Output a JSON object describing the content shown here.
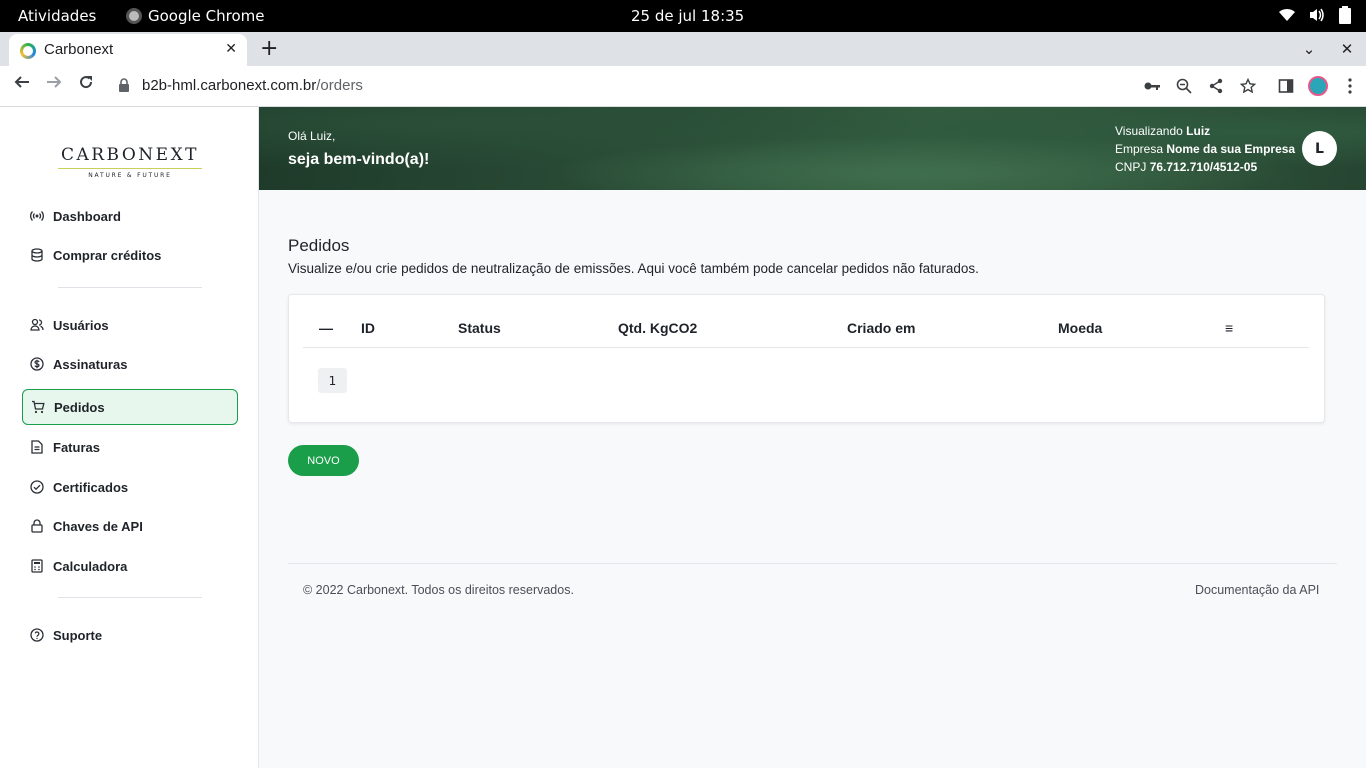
{
  "system_bar": {
    "activities": "Atividades",
    "app_name": "Google Chrome",
    "clock": "25 de jul  18:35"
  },
  "browser": {
    "tab_title": "Carbonext",
    "tab_close": "✕",
    "new_tab": "+",
    "url_host": "b2b-hml.carbonext.com.br",
    "url_path": "/orders"
  },
  "sidebar": {
    "logo_brand": "CARBONEXT",
    "logo_tag": "NATURE & FUTURE",
    "items": [
      {
        "label": "Dashboard",
        "icon": "broadcast-icon"
      },
      {
        "label": "Comprar créditos",
        "icon": "database-icon"
      },
      {
        "label": "Usuários",
        "icon": "users-icon"
      },
      {
        "label": "Assinaturas",
        "icon": "dollar-circle-icon"
      },
      {
        "label": "Pedidos",
        "icon": "cart-icon"
      },
      {
        "label": "Faturas",
        "icon": "file-icon"
      },
      {
        "label": "Certificados",
        "icon": "check-circle-icon"
      },
      {
        "label": "Chaves de API",
        "icon": "lock-icon"
      },
      {
        "label": "Calculadora",
        "icon": "calculator-icon"
      },
      {
        "label": "Suporte",
        "icon": "help-circle-icon"
      }
    ],
    "active_item": "Pedidos"
  },
  "header": {
    "greeting": "Olá Luiz,",
    "welcome": "seja bem-vindo(a)!",
    "viewing_label": "Visualizando",
    "viewing_user": "Luiz",
    "company_label": "Empresa",
    "company_name": "Nome da sua Empresa",
    "cnpj_label": "CNPJ",
    "cnpj_value": "76.712.710/4512-05",
    "avatar_initial": "L"
  },
  "main": {
    "title": "Pedidos",
    "description": "Visualize e/ou crie pedidos de neutralização de emissões. Aqui você também pode cancelar pedidos não faturados.",
    "table": {
      "columns": [
        "—",
        "ID",
        "Status",
        "Qtd. KgCO2",
        "Criado em",
        "Moeda",
        "≡"
      ],
      "rows": []
    },
    "pagination_page": "1",
    "new_button": "NOVO"
  },
  "footer": {
    "copyright": "© 2022 Carbonext. Todos os direitos reservados.",
    "api_link": "Documentação da API"
  },
  "colors": {
    "accent_green": "#1a9e4a",
    "active_bg": "#e8f7ed"
  }
}
